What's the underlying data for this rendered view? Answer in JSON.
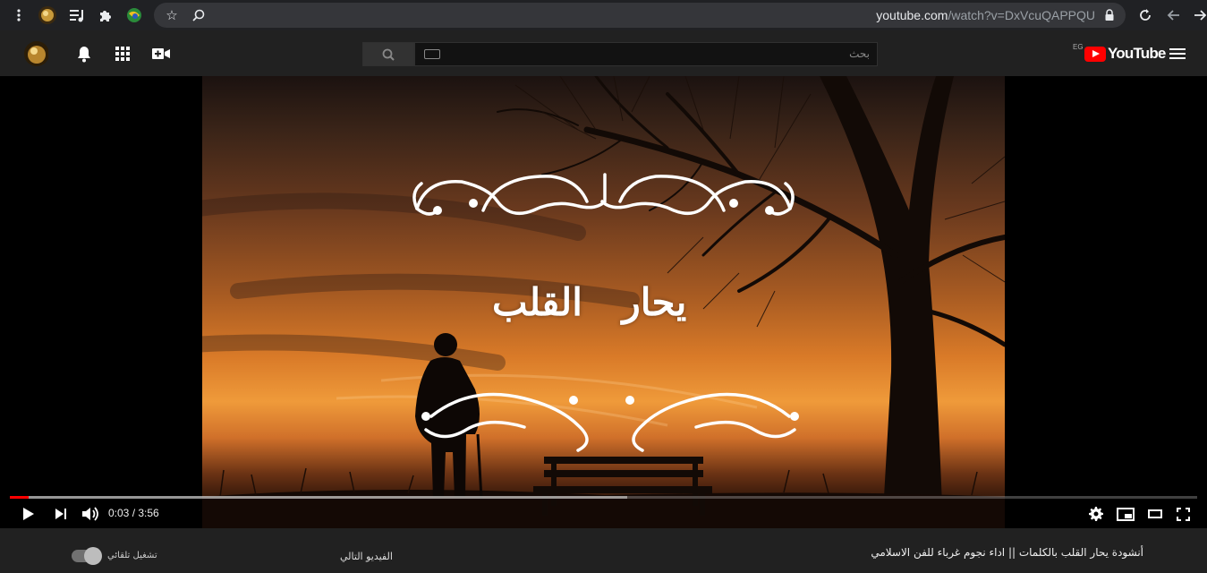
{
  "browser": {
    "url_host": "youtube.com",
    "url_path": "/watch?v=DxVcuQAPPQU"
  },
  "header": {
    "search_placeholder": "بحث",
    "country_code": "EG",
    "logo_text": "YouTube"
  },
  "video": {
    "overlay_title": "يحار القلب",
    "time_display": "0:03 / 3:56",
    "progress": 0.016,
    "buffered": 0.52
  },
  "below": {
    "autoplay_label": "تشغيل تلقائي",
    "autoplay_on": true,
    "next_label": "الفيديو التالي",
    "video_title": "أنشودة يحار القلب بالكلمات || اداء نجوم غرباء للفن الاسلامي"
  },
  "colors": {
    "accent": "#ff0000",
    "header_bg": "#212121",
    "chrome_bg": "#202124"
  }
}
